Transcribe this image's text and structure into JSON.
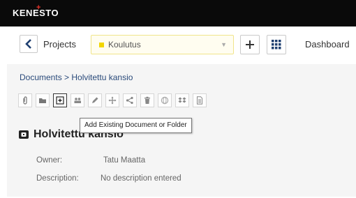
{
  "app": {
    "logo_text": "KENESTO",
    "brand_colors": {
      "topbar": "#0a0a0a",
      "accent": "#e8332a",
      "project_swatch": "#f2d600"
    }
  },
  "nav": {
    "back_icon": "chevron-left-icon",
    "projects_label": "Projects",
    "project_select_value": "Koulutus",
    "add_icon": "plus-icon",
    "grid_icon": "grid-icon",
    "dashboard_label": "Dashboard"
  },
  "breadcrumb": "Documents > Holvitettu kansio",
  "toolbar": {
    "buttons": [
      {
        "icon": "paperclip-icon"
      },
      {
        "icon": "folder-icon"
      },
      {
        "icon": "add-existing-icon"
      },
      {
        "icon": "users-icon"
      },
      {
        "icon": "pencil-icon"
      },
      {
        "icon": "move-icon"
      },
      {
        "icon": "share-icon"
      },
      {
        "icon": "trash-icon"
      },
      {
        "icon": "globe-icon"
      },
      {
        "icon": "dropbox-icon"
      },
      {
        "icon": "document-icon"
      }
    ],
    "tooltip": "Add Existing Document or Folder"
  },
  "folder": {
    "title": "Holvitettu kansio",
    "owner_label": "Owner:",
    "owner_value": "Tatu Maatta",
    "description_label": "Description:",
    "description_value": "No description entered"
  }
}
